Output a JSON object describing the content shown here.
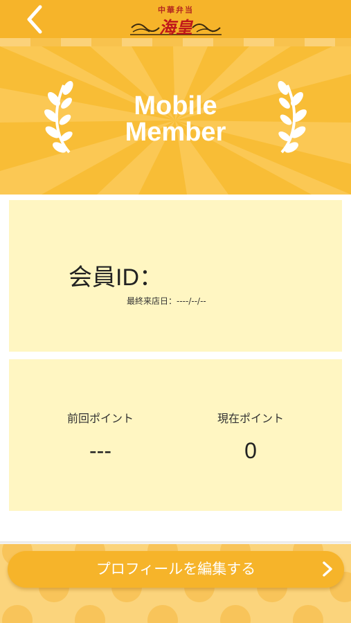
{
  "header": {
    "logo_small_text": "中華弁当",
    "logo_main_text": "海皇"
  },
  "banner": {
    "title_line1": "Mobile",
    "title_line2": "Member"
  },
  "member": {
    "id_label": "会員ID：",
    "last_visit_label": "最終来店日：----/--/--"
  },
  "points": {
    "previous_label": "前回ポイント",
    "previous_value": "---",
    "current_label": "現在ポイント",
    "current_value": "0"
  },
  "footer": {
    "edit_profile_label": "プロフィールを編集する"
  },
  "colors": {
    "accent": "#f6b42a",
    "panel": "#fff6c2",
    "banner": "#f8bd36"
  }
}
